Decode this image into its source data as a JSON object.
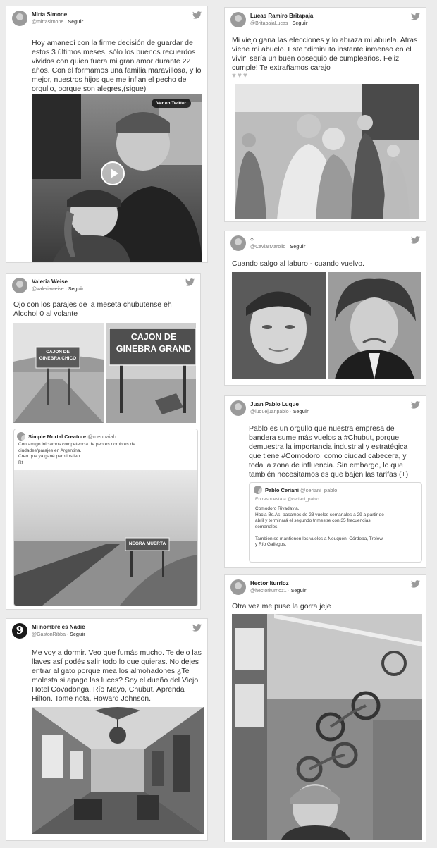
{
  "follow_label": "Seguir",
  "tweets": {
    "mirta": {
      "name": "Mirta Simone",
      "handle": "@mirtasimone",
      "text": "Hoy amanecí con la firme decisión de guardar de\nestos 3 últimos meses, sólo los buenos recuerdos\nvividos con quien fuera mi gran amor durante 22\naños. Con él formamos una familia maravillosa, y lo\nmejor, nuestros hijos que me inflan el pecho de\norgullo, porque son alegres,(sigue)",
      "video_badge": "Ver en Twitter"
    },
    "lucas": {
      "name": "Lucas Ramiro Britapaja",
      "handle": "@BritapajaLucas",
      "text": "Mi viejo gana las elecciones y lo abraza mi abuela. Atras\nviene mi abuelo. Este \"diminuto instante inmenso en el\nvivir\" sería un buen obsequio de cumpleaños. Feliz\ncumple! Te extrañamos carajo",
      "hearts": "♥♥♥"
    },
    "caviar": {
      "name": "○",
      "handle": "@CaviarMarolio",
      "text": "Cuando salgo al laburo - cuando vuelvo."
    },
    "valeria": {
      "name": "Valeria Weise",
      "handle": "@valeriaweise",
      "text": "Ojo con los parajes de la meseta chubutense eh\nAlcohol 0 al volante",
      "sign_left": "CAJON DE\nGINEBRA CHICO",
      "sign_right": "CAJON DE\nGINEBRA GRAND",
      "quote": {
        "name": "Simple Mortal Creature",
        "handle": "@mennaiah",
        "text": "Con amigo iniciamos competencia de peores nombres de\nciudades/parajes en Argentina.\nCreo que ya gané     pero los leo.\nRt",
        "sign": "NEGRA MUERTA"
      }
    },
    "juan": {
      "name": "Juan Pablo Luque",
      "handle": "@luquejuanpablo",
      "text": "Pablo es un orgullo que nuestra empresa de\nbandera sume más vuelos a #Chubut, porque\ndemuestra la importancia industrial y estratégica\nque tiene #Comodoro, como ciudad cabecera, y\ntoda la zona de influencia. Sin embargo, lo que\ntambién necesitamos es que bajen las tarifas (+)",
      "quote": {
        "name": "Pablo Ceriani",
        "handle": "@ceriani_pablo",
        "reply": "En respuesta a @ceriani_pablo",
        "text": "Comodoro Rivadavia.\n Hacia Bs.As.  pasamos de 23 vuelos semanales a 29 a partir de\nabril y terminará el segundo trimestre con 35 frecuencias\nsemanales.\n\n También se mantienen los vuelos a Neuquén, Córdoba, Trelew\ny Río Gallegos."
      }
    },
    "gaston": {
      "name": "Mi nombre es Nadie",
      "handle": "@GastonRibba",
      "avatar_glyph": "9",
      "text": "Me voy a dormir. Veo que fumás mucho. Te dejo las\nllaves así podés salir todo lo que quieras. No dejes\nentrar al gato porque mea los almohadones ¿Te\nmolesta si apago las luces? Soy el dueño del Viejo\nHotel Covadonga, Río Mayo, Chubut. Aprenda\nHilton. Tome nota, Howard Johnson."
    },
    "hector": {
      "name": "Hector Iturrioz",
      "handle": "@hectoriturrioz1",
      "text": "Otra vez me puse la gorra jeje"
    }
  }
}
